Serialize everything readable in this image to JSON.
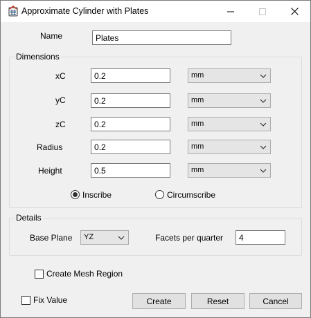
{
  "window": {
    "title": "Approximate Cylinder with Plates"
  },
  "name_row": {
    "label": "Name",
    "value": "Plates"
  },
  "dimensions": {
    "title": "Dimensions",
    "rows": [
      {
        "label": "xC",
        "value": "0.2",
        "unit": "mm"
      },
      {
        "label": "yC",
        "value": "0.2",
        "unit": "mm"
      },
      {
        "label": "zC",
        "value": "0.2",
        "unit": "mm"
      },
      {
        "label": "Radius",
        "value": "0.2",
        "unit": "mm"
      },
      {
        "label": "Height",
        "value": "0.5",
        "unit": "mm"
      }
    ],
    "inscribe_label": "Inscribe",
    "circumscribe_label": "Circumscribe",
    "selected_mode": "Inscribe"
  },
  "details": {
    "title": "Details",
    "base_plane_label": "Base Plane",
    "base_plane_value": "YZ",
    "facets_label": "Facets per quarter",
    "facets_value": "4"
  },
  "create_mesh_region_label": "Create Mesh Region",
  "fix_value_label": "Fix Value",
  "buttons": {
    "create": "Create",
    "reset": "Reset",
    "cancel": "Cancel"
  }
}
